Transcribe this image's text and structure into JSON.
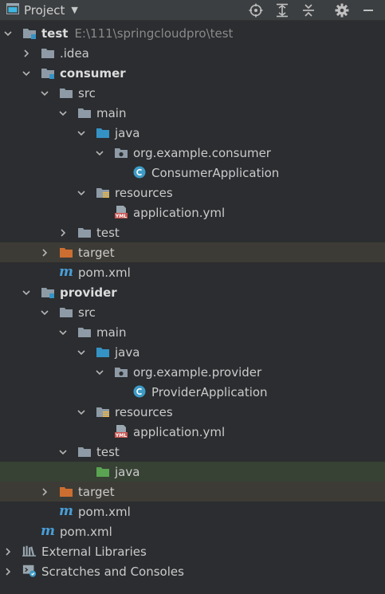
{
  "header": {
    "title": "Project",
    "icons": [
      "project-window-icon",
      "caret-down-icon",
      "locate-icon",
      "expand-all-icon",
      "collapse-all-icon",
      "gear-icon",
      "minimize-icon"
    ]
  },
  "tree": [
    {
      "depth": 0,
      "expanded": true,
      "icon": "module-folder",
      "label": "test",
      "bold": true,
      "path": "E:\\111\\springcloudpro\\test"
    },
    {
      "depth": 1,
      "expanded": false,
      "icon": "folder",
      "label": ".idea"
    },
    {
      "depth": 1,
      "expanded": true,
      "icon": "module-folder",
      "label": "consumer",
      "bold": true
    },
    {
      "depth": 2,
      "expanded": true,
      "icon": "folder",
      "label": "src"
    },
    {
      "depth": 3,
      "expanded": true,
      "icon": "folder",
      "label": "main"
    },
    {
      "depth": 4,
      "expanded": true,
      "icon": "source-folder",
      "label": "java"
    },
    {
      "depth": 5,
      "expanded": true,
      "icon": "package",
      "label": "org.example.consumer"
    },
    {
      "depth": 6,
      "icon": "class",
      "label": "ConsumerApplication"
    },
    {
      "depth": 4,
      "expanded": true,
      "icon": "resources-folder",
      "label": "resources"
    },
    {
      "depth": 5,
      "icon": "yml",
      "label": "application.yml"
    },
    {
      "depth": 3,
      "expanded": false,
      "icon": "folder",
      "label": "test"
    },
    {
      "depth": 2,
      "expanded": false,
      "icon": "excluded-folder",
      "label": "target",
      "highlight": "orange"
    },
    {
      "depth": 2,
      "icon": "maven",
      "label": "pom.xml"
    },
    {
      "depth": 1,
      "expanded": true,
      "icon": "module-folder",
      "label": "provider",
      "bold": true
    },
    {
      "depth": 2,
      "expanded": true,
      "icon": "folder",
      "label": "src"
    },
    {
      "depth": 3,
      "expanded": true,
      "icon": "folder",
      "label": "main"
    },
    {
      "depth": 4,
      "expanded": true,
      "icon": "source-folder",
      "label": "java"
    },
    {
      "depth": 5,
      "expanded": true,
      "icon": "package",
      "label": "org.example.provider"
    },
    {
      "depth": 6,
      "icon": "class",
      "label": "ProviderApplication"
    },
    {
      "depth": 4,
      "expanded": true,
      "icon": "resources-folder",
      "label": "resources"
    },
    {
      "depth": 5,
      "icon": "yml",
      "label": "application.yml"
    },
    {
      "depth": 3,
      "expanded": true,
      "icon": "folder",
      "label": "test"
    },
    {
      "depth": 4,
      "icon": "test-folder",
      "label": "java",
      "highlight": "green"
    },
    {
      "depth": 2,
      "expanded": false,
      "icon": "excluded-folder",
      "label": "target",
      "highlight": "orange"
    },
    {
      "depth": 2,
      "icon": "maven",
      "label": "pom.xml"
    },
    {
      "depth": 1,
      "icon": "maven",
      "label": "pom.xml"
    },
    {
      "depth": 0,
      "expanded": false,
      "icon": "libraries",
      "label": "External Libraries"
    },
    {
      "depth": 0,
      "expanded": false,
      "icon": "scratches",
      "label": "Scratches and Consoles"
    }
  ],
  "colors": {
    "folder": "#8e9ba6",
    "source": "#3592c4",
    "test": "#5aa352",
    "excluded": "#cc6e31",
    "class": "#3d9bc6",
    "yml": "#c75450",
    "highlight_orange": "#3d3b35",
    "highlight_green": "#374134"
  }
}
